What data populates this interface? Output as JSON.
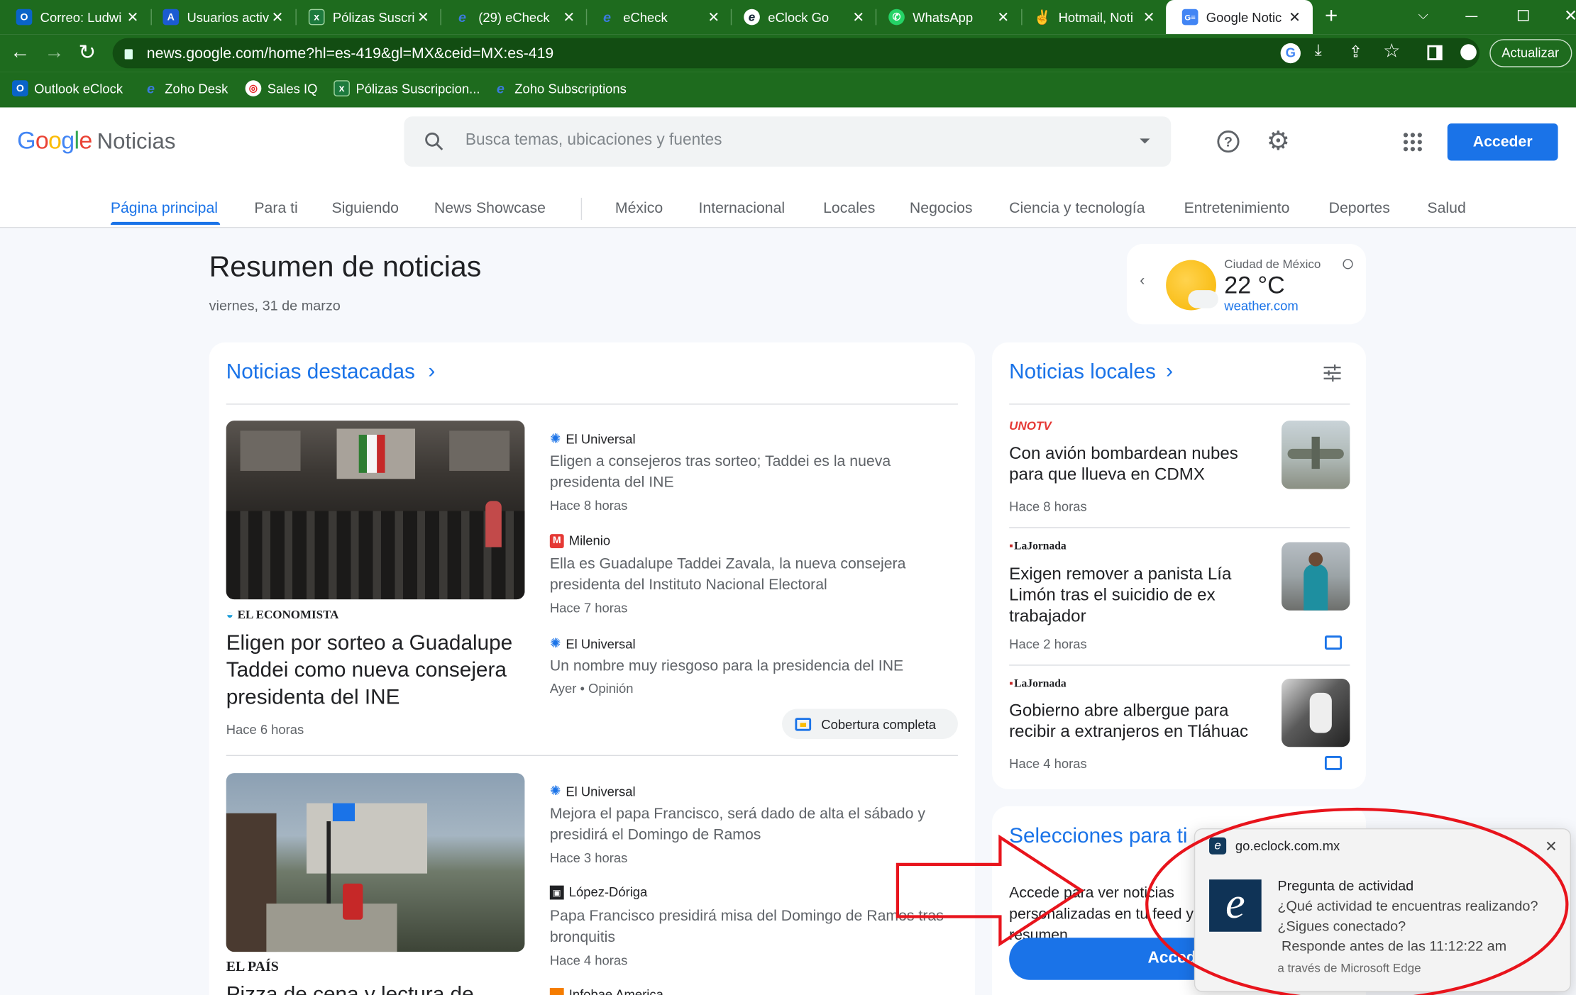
{
  "browser": {
    "tabs": [
      {
        "label": "Correo: Ludwi",
        "icon": "outlook-icon"
      },
      {
        "label": "Usuarios activ",
        "icon": "azure-icon"
      },
      {
        "label": "Pólizas Suscri",
        "icon": "excel-icon"
      },
      {
        "label": "(29) eCheck",
        "icon": "echeck-icon"
      },
      {
        "label": "eCheck",
        "icon": "echeck-icon"
      },
      {
        "label": "eClock Go",
        "icon": "eclock-icon"
      },
      {
        "label": "WhatsApp",
        "icon": "whatsapp-icon"
      },
      {
        "label": "Hotmail, Noti",
        "icon": "hotmail-icon"
      },
      {
        "label": "Google Notic",
        "icon": "google-news-icon"
      }
    ],
    "new_tab": "+",
    "url": "news.google.com/home?hl=es-419&gl=MX&ceid=MX:es-419",
    "update_button": "Actualizar",
    "bookmarks": [
      {
        "label": "Outlook eClock",
        "icon": "outlook-icon"
      },
      {
        "label": "Zoho Desk",
        "icon": "zoho-desk-icon"
      },
      {
        "label": "Sales IQ",
        "icon": "salesiq-icon"
      },
      {
        "label": "Pólizas Suscripcion...",
        "icon": "excel-icon"
      },
      {
        "label": "Zoho Subscriptions",
        "icon": "zoho-subscriptions-icon"
      }
    ]
  },
  "header": {
    "logo_google": "Google",
    "logo_noticias": "Noticias",
    "search_placeholder": "Busca temas, ubicaciones y fuentes",
    "signin": "Acceder"
  },
  "nav": [
    "Página principal",
    "Para ti",
    "Siguiendo",
    "News Showcase",
    "México",
    "Internacional",
    "Locales",
    "Negocios",
    "Ciencia y tecnología",
    "Entretenimiento",
    "Deportes",
    "Salud"
  ],
  "summary": {
    "title": "Resumen de noticias",
    "date": "viernes, 31 de marzo"
  },
  "weather": {
    "city": "Ciudad de México",
    "temp": "22 °C",
    "source": "weather.com"
  },
  "top": {
    "heading": "Noticias destacadas",
    "story1": {
      "source": "EL ECONOMISTA",
      "headline": "Eligen por sorteo a Guadalupe Taddei como nueva consejera presidenta del INE",
      "time": "Hace 6 horas",
      "related": [
        {
          "source": "El Universal",
          "title": "Eligen a consejeros tras sorteo; Taddei es la nueva presidenta del INE",
          "time": "Hace 8 horas"
        },
        {
          "source": "Milenio",
          "title": "Ella es Guadalupe Taddei Zavala, la nueva consejera presidenta del Instituto Nacional Electoral",
          "time": "Hace 7 horas"
        },
        {
          "source": "El Universal",
          "title": "Un nombre muy riesgoso para la presidencia del INE",
          "time": "Ayer • Opinión"
        }
      ],
      "coverage": "Cobertura completa"
    },
    "story2": {
      "source": "EL PAÍS",
      "headline": "Pizza de cena y lectura de",
      "related": [
        {
          "source": "El Universal",
          "title": "Mejora el papa Francisco, será dado de alta el sábado y presidirá el Domingo de Ramos",
          "time": "Hace 3 horas"
        },
        {
          "source": "López-Dóriga",
          "title": "Papa Francisco presidirá misa del Domingo de Ramos tras bronquitis",
          "time": "Hace 4 horas"
        },
        {
          "source": "Infobae America",
          "title": "",
          "time": ""
        }
      ]
    }
  },
  "local": {
    "heading": "Noticias locales",
    "items": [
      {
        "source": "UNOTV",
        "title": "Con avión bombardean nubes para que llueva en CDMX",
        "time": "Hace 8 horas"
      },
      {
        "source": "LaJornada",
        "title": "Exigen remover a panista Lía Limón tras el suicidio de ex trabajador",
        "time": "Hace 2 horas"
      },
      {
        "source": "LaJornada",
        "title": "Gobierno abre albergue para recibir a extranjeros en Tláhuac",
        "time": "Hace 4 horas"
      }
    ]
  },
  "picks": {
    "heading": "Selecciones para ti",
    "text": "Accede para ver noticias personalizadas en tu feed y tu resumen",
    "button": "Acceder"
  },
  "toast": {
    "site": "go.eclock.com.mx",
    "title": "Pregunta de actividad",
    "line1": "¿Qué actividad te encuentras realizando?",
    "line2": "¿Sigues conectado?",
    "line3": "Responde antes de las 11:12:22 am",
    "via": "a través de Microsoft Edge"
  },
  "colors": {
    "accent": "#1a73e8",
    "chrome": "#1e6b1e",
    "annotation": "#e8141c"
  }
}
